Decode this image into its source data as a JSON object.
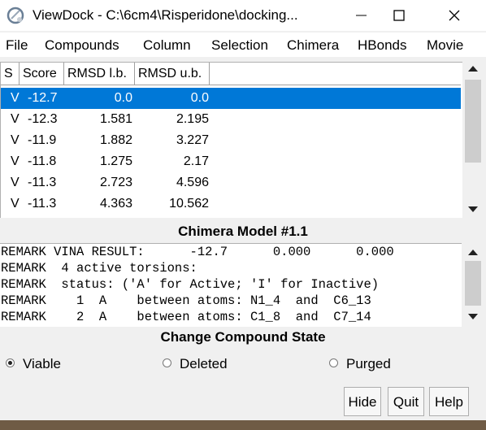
{
  "window": {
    "title": "ViewDock - C:\\6cm4\\Risperidone\\docking..."
  },
  "menu": [
    "File",
    "Compounds",
    "Column",
    "Selection",
    "Chimera",
    "HBonds",
    "Movie"
  ],
  "table": {
    "headers": [
      "S",
      "Score",
      "RMSD l.b.",
      "RMSD u.b."
    ],
    "rows": [
      [
        "V",
        "-12.7",
        "0.0",
        "0.0"
      ],
      [
        "V",
        "-12.3",
        "1.581",
        "2.195"
      ],
      [
        "V",
        "-11.9",
        "1.882",
        "3.227"
      ],
      [
        "V",
        "-11.8",
        "1.275",
        "2.17"
      ],
      [
        "V",
        "-11.3",
        "2.723",
        "4.596"
      ],
      [
        "V",
        "-11.3",
        "4.363",
        "10.562"
      ]
    ],
    "selected_row": 0
  },
  "model_title": "Chimera Model #1.1",
  "remarks": [
    "REMARK VINA RESULT:      -12.7      0.000      0.000",
    "REMARK  4 active torsions:",
    "REMARK  status: ('A' for Active; 'I' for Inactive)",
    "REMARK    1  A    between atoms: N1_4  and  C6_13",
    "REMARK    2  A    between atoms: C1_8  and  C7_14"
  ],
  "state": {
    "title": "Change Compound State",
    "options": [
      "Viable",
      "Deleted",
      "Purged"
    ],
    "selected": "Viable"
  },
  "buttons": {
    "hide": "Hide",
    "quit": "Quit",
    "help": "Help"
  },
  "colors": {
    "selection": "#0078d7"
  }
}
